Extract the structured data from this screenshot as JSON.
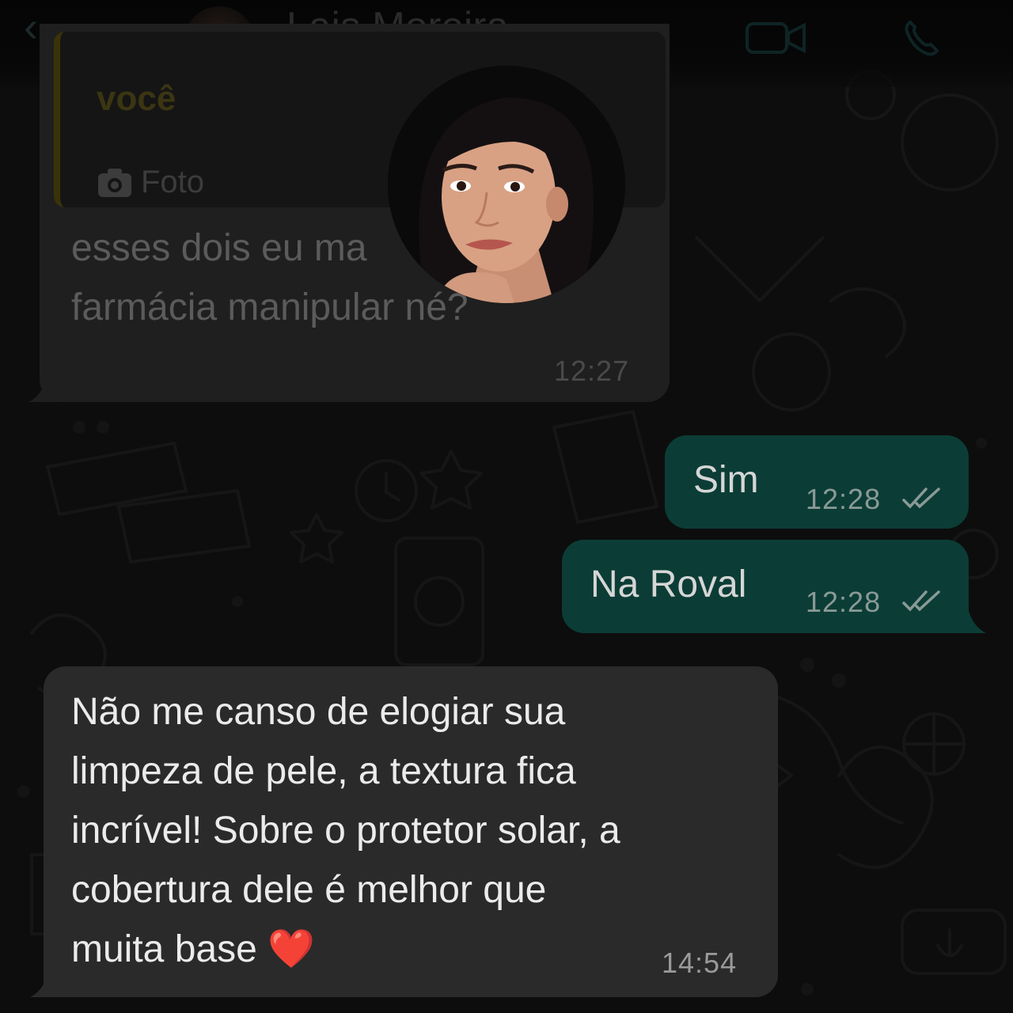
{
  "header": {
    "contact_name": "Lais Moreira",
    "back_icon": "back-chevron-icon"
  },
  "messages": [
    {
      "direction": "incoming",
      "quote": {
        "author": "você",
        "type_label": "Foto",
        "icon": "camera-icon"
      },
      "text": "esses dois eu ma\nfarmácia manipular né?",
      "time": "12:27"
    },
    {
      "direction": "outgoing",
      "text": "Sim",
      "time": "12:28",
      "status": "read"
    },
    {
      "direction": "outgoing",
      "text": "Na Roval",
      "time": "12:28",
      "status": "read"
    },
    {
      "direction": "incoming",
      "text": "Não me canso de elogiar sua\nlimpeza de pele, a textura fica\nincrível! Sobre o protetor solar, a\ncobertura dele é melhor que\nmuita base ❤️",
      "time": "14:54"
    }
  ],
  "colors": {
    "incoming_bubble": "#1f1f1f",
    "outgoing_bubble": "#0b3d36",
    "read_ticks": "#8a9a96"
  }
}
